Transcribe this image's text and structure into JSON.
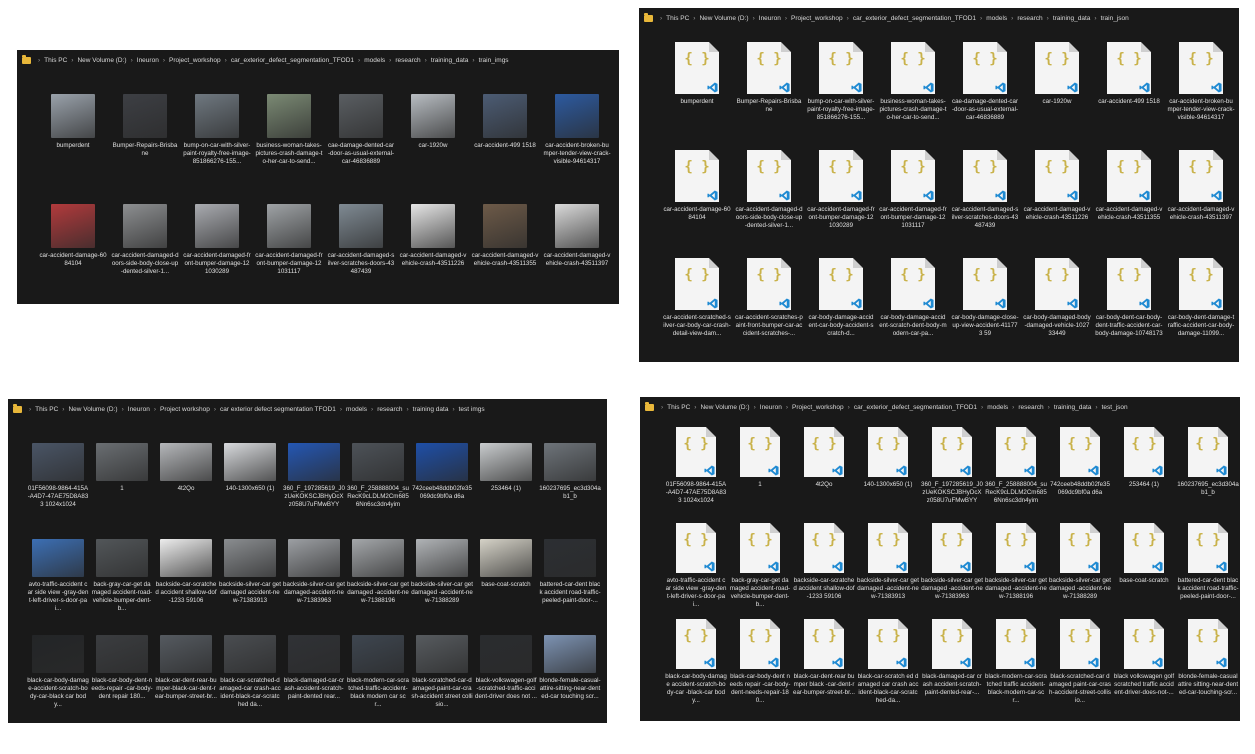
{
  "windows": [
    {
      "id": "train-imgs",
      "breadcrumb": [
        "This PC",
        "New Volume (D:)",
        "Ineuron",
        "Project_workshop",
        "car_exterior_defect_segmentation_TFOD1",
        "models",
        "research",
        "training_data",
        "train_imgs"
      ],
      "type": "images",
      "items": [
        {
          "label": "bumperdent",
          "color": "#9aa2ab"
        },
        {
          "label": "Bumper-Repairs-Brisbane",
          "color": "#3d3f44"
        },
        {
          "label": "bump-on-car-with-silver-paint-royalty-free-image-851866276-155...",
          "color": "#6f7880"
        },
        {
          "label": "business-woman-takes-pictures-crash-damage-to-her-car-to-send...",
          "color": "#7b8a74"
        },
        {
          "label": "cae-damage-dented-car-door-as-usual-external-car-46836889",
          "color": "#5a5e62"
        },
        {
          "label": "car-1920w",
          "color": "#b8bdc2"
        },
        {
          "label": "car-accident-499 1518",
          "color": "#4c5c74"
        },
        {
          "label": "car-accident-broken-bumper-tender-view-crack-visible-94614317",
          "color": "#2c5aa0"
        },
        {
          "label": "car-accident-damage-6084104",
          "color": "#b23a3c"
        },
        {
          "label": "car-accident-damaged-doors-side-body-close-up-dented-silver-1...",
          "color": "#8d8f91"
        },
        {
          "label": "car-accident-damaged-front-bumper-damage-121030289",
          "color": "#a9abb0"
        },
        {
          "label": "car-accident-damaged-front-bumper-damage-121031117",
          "color": "#9fa3a6"
        },
        {
          "label": "car-accident-damaged-silver-scratches-doors-43487439",
          "color": "#7f8a93"
        },
        {
          "label": "car-accident-damaged-vehicle-crash-43511226",
          "color": "#e6e6e6"
        },
        {
          "label": "car-accident-damaged-vehicle-crash-43511355",
          "color": "#6d5a48"
        },
        {
          "label": "car-accident-damaged-vehicle-crash-43511397",
          "color": "#dadada"
        }
      ]
    },
    {
      "id": "train-json",
      "breadcrumb": [
        "This PC",
        "New Volume (D:)",
        "Ineuron",
        "Project_workshop",
        "car_exterior_defect_segmentation_TFOD1",
        "models",
        "research",
        "training_data",
        "train_json"
      ],
      "type": "json",
      "icon": "json-vscode-file-icon",
      "items": [
        {
          "label": "bumperdent"
        },
        {
          "label": "Bumper-Repairs-Brisbane"
        },
        {
          "label": "bump-on-car-with-silver-paint-royalty-free-image-851866276-155..."
        },
        {
          "label": "business-woman-takes-pictures-crash-damage-to-her-car-to-send..."
        },
        {
          "label": "cae-damage-dented-car-door-as-usual-external-car-46836889"
        },
        {
          "label": "car-1920w"
        },
        {
          "label": "car-accident-499 1518"
        },
        {
          "label": "car-accident-broken-bumper-tender-view-crack-visible-94614317"
        },
        {
          "label": "car-accident-damage-6084104"
        },
        {
          "label": "car-accident-damaged-doors-side-body-close-up-dented-silver-1..."
        },
        {
          "label": "car-accident-damaged-front-bumper-damage-121030289"
        },
        {
          "label": "car-accident-damaged-front-bumper-damage-121031117"
        },
        {
          "label": "car-accident-damaged-silver-scratches-doors-43487439"
        },
        {
          "label": "car-accident-damaged-vehicle-crash-43511226"
        },
        {
          "label": "car-accident-damaged-vehicle-crash-43511355"
        },
        {
          "label": "car-accident-damaged-vehicle-crash-43511397"
        },
        {
          "label": "car-accident-scratched-silver-car-body-car-crash-detail-view-dam..."
        },
        {
          "label": "car-accident-scratches-paint-front-bumper-car-accident-scratches-..."
        },
        {
          "label": "car-body-damage-accident-car-body-accident-scratch-d..."
        },
        {
          "label": "car-body-damage-accident-scratch-dent-body-modern-car-pa..."
        },
        {
          "label": "car-body-damage-close-up-view-accident-411773 59"
        },
        {
          "label": "car-body-damaged-body-damaged-vehicle-102733449"
        },
        {
          "label": "car-body-dent-car-body-dent-traffic-accident-car-body-damage-10748173"
        },
        {
          "label": "car-body-dent-damage-traffic-accident-car-body-damage-11099..."
        }
      ]
    },
    {
      "id": "test-imgs",
      "breadcrumb": [
        "This PC",
        "New Volume (D:)",
        "Ineuron",
        "Project workshop",
        "car exterior defect segmentation TFOD1",
        "models",
        "research",
        "training data",
        "test imgs"
      ],
      "type": "images",
      "items": [
        {
          "label": "01F56098-9864-415A-A4D7-47AE75D8A833 1024x1024",
          "color": "#4a5566"
        },
        {
          "label": "1",
          "color": "#6a6e72"
        },
        {
          "label": "4t2Qo",
          "color": "#b5b7ba"
        },
        {
          "label": "140-1300x650 (1)",
          "color": "#d8dadd"
        },
        {
          "label": "360_F_197285619_J0zUeKOKSCJBHyDcXz058U7uFMwBYY",
          "color": "#2457b4"
        },
        {
          "label": "360_F_258888004_suRecK9cLDLM2Cm6856Nn6sc3dn4yim",
          "color": "#4d5258"
        },
        {
          "label": "742ceeb48ddb02fe35069dc9bf0a d6a",
          "color": "#1e4fa8"
        },
        {
          "label": "253464 (1)",
          "color": "#c9ccce"
        },
        {
          "label": "160237695_ec3d304ab1_b",
          "color": "#6e747a"
        },
        {
          "label": "avto-traffic-accident car side view -gray-dent-left-driver-s-door-pai...",
          "color": "#3c6fb4"
        },
        {
          "label": "back-gray-car-get damaged accident-road-vehicle-bumper-dent-b...",
          "color": "#525659"
        },
        {
          "label": "backside-car-scratched accident shallow-dof-1233 59106",
          "color": "#ededed"
        },
        {
          "label": "backside-silver-car get damaged accident-new-71383913",
          "color": "#8a8d90"
        },
        {
          "label": "backside-silver-car get damaged-accident-new-71383963",
          "color": "#9c9fa3"
        },
        {
          "label": "backside-silver-car get damaged -accident-new-71388196",
          "color": "#a4a7aa"
        },
        {
          "label": "backside-silver-car get damaged -accident-new-71388289",
          "color": "#b0b3b6"
        },
        {
          "label": "base-coat-scratch",
          "color": "#d5d2c7"
        },
        {
          "label": "battered-car-dent black accident road-traffic-peeled-paint-door-...",
          "color": "#2c2f33"
        },
        {
          "label": "black-car-body-damage-accident-scratch-body-car-black car body...",
          "color": "#232527"
        },
        {
          "label": "black-car-body-dent-needs-repair -car-body-dent repair 180...",
          "color": "#3b3d40"
        },
        {
          "label": "black-car-dent-rear-bumper-black-car-dent-rear-bumper-street-br...",
          "color": "#555a60"
        },
        {
          "label": "black-car-scratched-damaged-car crash-accident-black-car-scratched da...",
          "color": "#4a4d51"
        },
        {
          "label": "black-damaged-car-crash-accident-scratch-paint-dented rear...",
          "color": "#303236"
        },
        {
          "label": "black-modern-car-scratched-traffic-accident-black modern car scr...",
          "color": "#3e4650"
        },
        {
          "label": "black-scratched-car-damaged-paint-car-crash-accident street collisio...",
          "color": "#575b5f"
        },
        {
          "label": "black-volkswagen-golf-scratched-traffic-accident-driver does not ...",
          "color": "#2a2c2f"
        },
        {
          "label": "blonde-female-casual-attire-sitting-near-dented-car touching scr...",
          "color": "#7d93b3"
        }
      ]
    },
    {
      "id": "test-json",
      "breadcrumb": [
        "This PC",
        "New Volume (D:)",
        "Ineuron",
        "Project_workshop",
        "car_exterior_defect_segmentation_TFOD1",
        "models",
        "research",
        "training_data",
        "test_json"
      ],
      "type": "json",
      "icon": "json-vscode-file-icon",
      "items": [
        {
          "label": "01F56098-9864-415A-A4D7-47AE75D8A833 1024x1024"
        },
        {
          "label": "1"
        },
        {
          "label": "4t2Qo"
        },
        {
          "label": "140-1300x650 (1)"
        },
        {
          "label": "360_F_197285619_J0zUeKOKSCJBHyDcXz058U7uFMwBYY"
        },
        {
          "label": "360_F_258888004_suRecK9cLDLM2Cm6856Nn6sc3dn4yim"
        },
        {
          "label": "742ceeb48ddb02fe35069dc9bf0a d6a"
        },
        {
          "label": "253464 (1)"
        },
        {
          "label": "160237695_ec3d304ab1_b"
        },
        {
          "label": "avto-traffic-accident car side view -gray-dent-left-driver-s-door-pai..."
        },
        {
          "label": "back-gray-car-get damaged accident-road-vehicle-bumper-dent-b..."
        },
        {
          "label": "backside-car-scratched accident shallow-dof-1233 59106"
        },
        {
          "label": "backside-silver-car get damaged -accident-new-71383913"
        },
        {
          "label": "backside-silver-car get damaged -accident-new-71383963"
        },
        {
          "label": "backside-silver-car get damaged -accident-new-71388196"
        },
        {
          "label": "backside-silver-car get damaged -accident-new-71388289"
        },
        {
          "label": "base-coat-scratch"
        },
        {
          "label": "battered-car-dent black accident road-traffic-peeled-paint-door-..."
        },
        {
          "label": "black-car-body-damage accident-scratch-body-car -black-car body..."
        },
        {
          "label": "black-car-body-dent needs repair -car-body-dent-needs-repair-180..."
        },
        {
          "label": "black-car-dent-rear bumper black -car-dent-rear-bumper-street-br..."
        },
        {
          "label": "black-car-scratch ed damaged car crash accident-black-car-scratched-da..."
        },
        {
          "label": "black-damaged-car crash accident-scratch-paint-dented-rear-..."
        },
        {
          "label": "black-modern-car-scratched traffic accident-black-modern-car-scr..."
        },
        {
          "label": "black-scratched-car damaged paint-car-crash-accident-street-collisio..."
        },
        {
          "label": "black volkswagen golf scratched traffic accident-driver-does-not-..."
        },
        {
          "label": "blonde-female-casual attire sitting-near-dented-car-touching-scr..."
        }
      ]
    }
  ]
}
